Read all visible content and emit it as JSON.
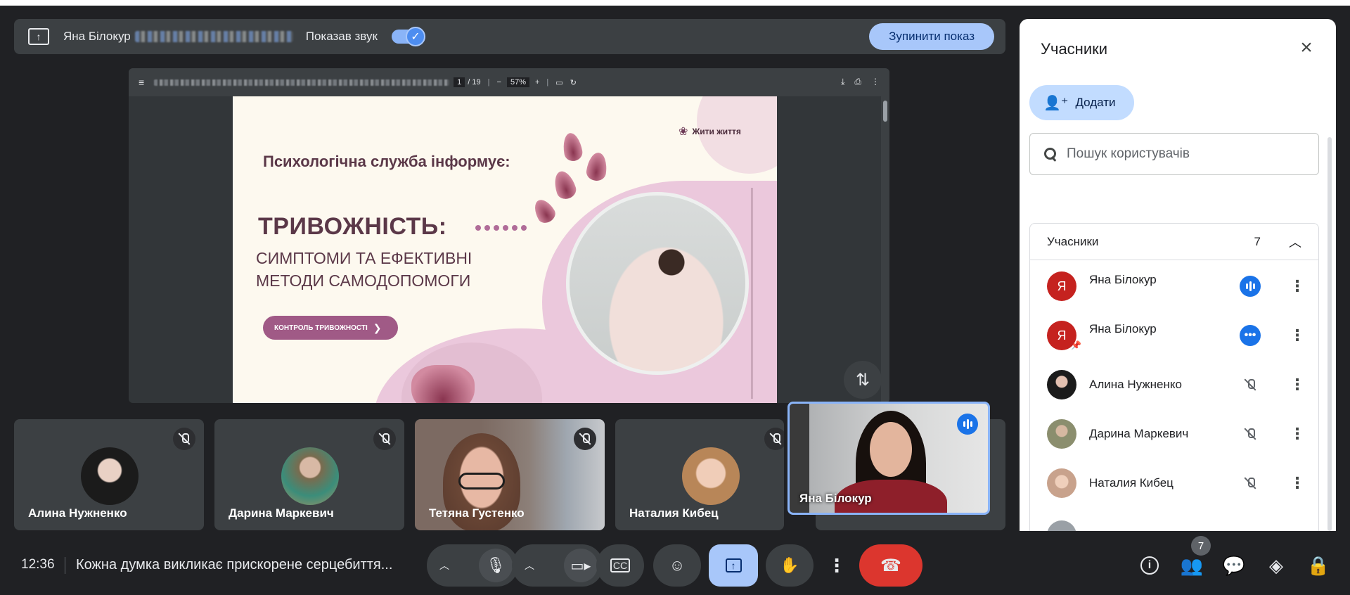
{
  "presentation_bar": {
    "presenter_name": "Яна Білокур",
    "sound_label": "Показав звук",
    "sound_enabled": true,
    "stop_button": "Зупинити показ"
  },
  "pdf_viewer": {
    "page_current": "1",
    "page_total": "/ 19",
    "zoom": "57%"
  },
  "slide": {
    "logo_text": "Жити життя",
    "heading": "Психологічна служба інформує:",
    "title": "ТРИВОЖНІСТЬ:",
    "subtitle_line1": "СИМПТОМИ ТА ЕФЕКТИВНІ",
    "subtitle_line2": "МЕТОДИ САМОДОПОМОГИ",
    "cta": "КОНТРОЛЬ ТРИВОЖНОСТІ"
  },
  "tiles": [
    {
      "name": "Алина Нужненко",
      "muted": true
    },
    {
      "name": "Дарина Маркевич",
      "muted": true
    },
    {
      "name": "Тетяна Густенко",
      "muted": true
    },
    {
      "name": "Наталия Кибец",
      "muted": true
    },
    {
      "name": "Яна Білокур",
      "speaking": true
    }
  ],
  "panel": {
    "title": "Учасники",
    "add_button": "Додати",
    "search_placeholder": "Пошук користувачів",
    "group_label": "Учасники",
    "group_count": "7",
    "participants": [
      {
        "name": "Яна Білокур",
        "initial": "Я",
        "status": "speaking",
        "color": "#c5221f"
      },
      {
        "name": "Яна Білокур",
        "initial": "Я",
        "status": "more",
        "color": "#c5221f"
      },
      {
        "name": "Алина Нужненко",
        "initial": "",
        "status": "muted",
        "color": "#2b2b2b"
      },
      {
        "name": "Дарина Маркевич",
        "initial": "",
        "status": "muted",
        "color": "#8b8e6e"
      },
      {
        "name": "Наталия Кибец",
        "initial": "",
        "status": "muted",
        "color": "#c8a28c"
      }
    ]
  },
  "bottom_bar": {
    "time": "12:36",
    "meeting_title": "Кожна думка викликає прискорене серцебиття...",
    "people_count": "7"
  },
  "colors": {
    "accent": "#8ab4f8",
    "end_call": "#dc362e",
    "speaking": "#1a73e8"
  }
}
